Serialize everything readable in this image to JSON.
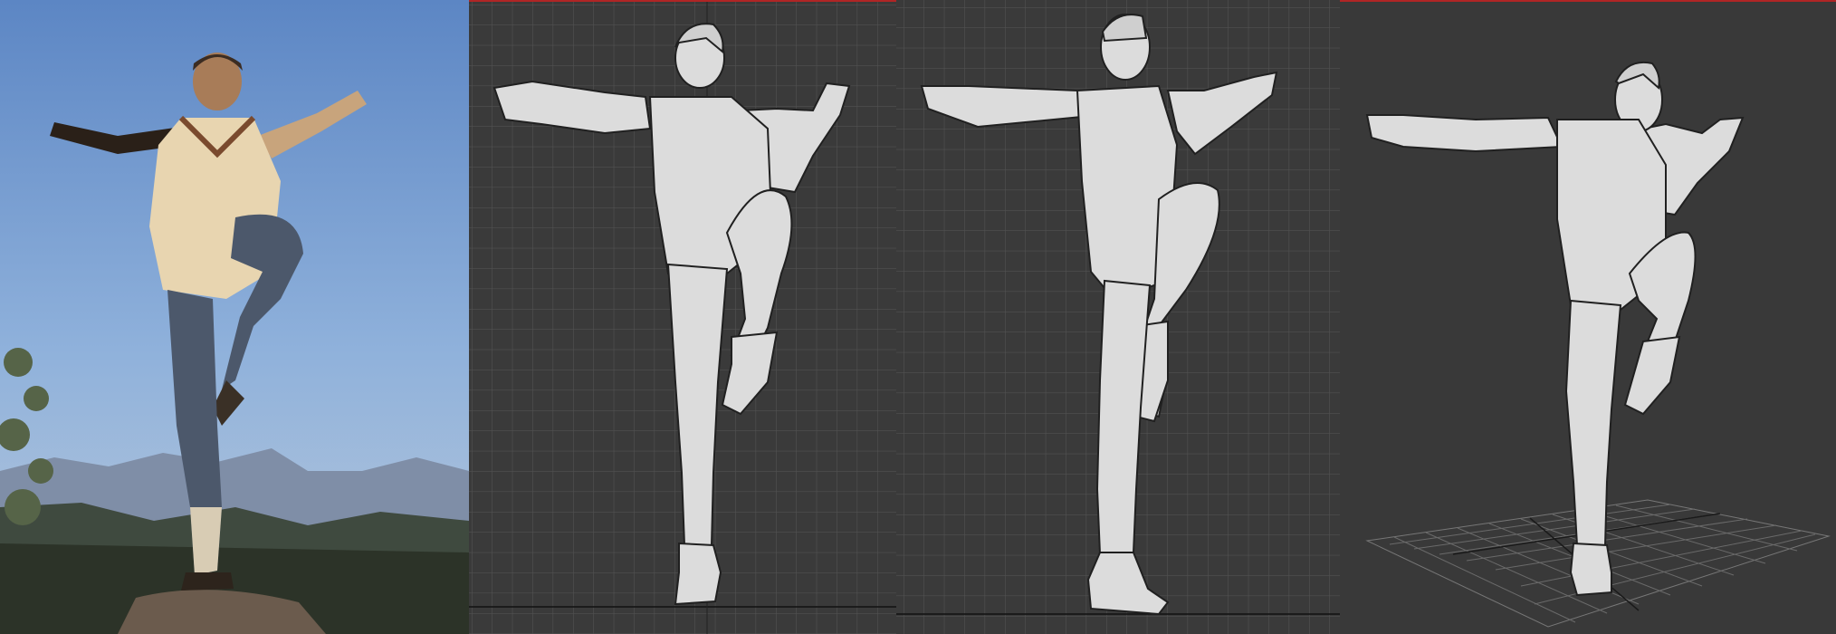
{
  "viewport_background": "#3a3a3a",
  "grid_line_color": "#565656",
  "active_viewport_border": "#b02525",
  "model_color": "#dcdcdc",
  "panels": [
    {
      "id": "reference-photo",
      "kind": "photo"
    },
    {
      "id": "front-viewport",
      "kind": "orthographic-grid",
      "active": true
    },
    {
      "id": "side-viewport",
      "kind": "orthographic-grid",
      "active": false
    },
    {
      "id": "perspective-viewport",
      "kind": "perspective-grid",
      "active": true
    }
  ]
}
